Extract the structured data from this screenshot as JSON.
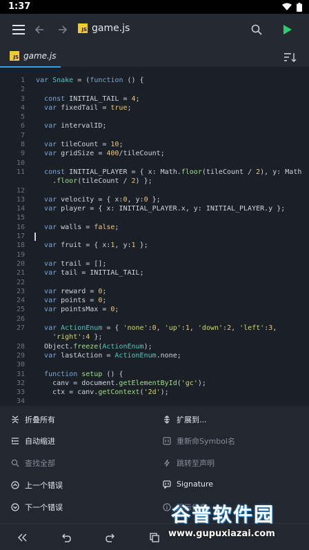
{
  "status_bar": {
    "time": "1:37"
  },
  "toolbar": {
    "filename": "game.js",
    "file_badge": "JS"
  },
  "tabs": [
    {
      "label": "game.js",
      "badge": "JS"
    }
  ],
  "editor": {
    "cursor_line": 17,
    "lines": [
      {
        "n": "1",
        "t": "var Snake = (function () {"
      },
      {
        "n": "2",
        "t": ""
      },
      {
        "n": "3",
        "t": "  const INITIAL_TAIL = 4;"
      },
      {
        "n": "4",
        "t": "  var fixedTail = true;"
      },
      {
        "n": "5",
        "t": ""
      },
      {
        "n": "6",
        "t": "  var intervalID;"
      },
      {
        "n": "7",
        "t": ""
      },
      {
        "n": "8",
        "t": "  var tileCount = 10;"
      },
      {
        "n": "9",
        "t": "  var gridSize = 400/tileCount;"
      },
      {
        "n": "10",
        "t": ""
      },
      {
        "n": "11",
        "t": "  const INITIAL_PLAYER = { x: Math.floor(tileCount / 2), y: Math"
      },
      {
        "n": "",
        "t": "    .floor(tileCount / 2) };"
      },
      {
        "n": "12",
        "t": ""
      },
      {
        "n": "13",
        "t": "  var velocity = { x:0, y:0 };"
      },
      {
        "n": "14",
        "t": "  var player = { x: INITIAL_PLAYER.x, y: INITIAL_PLAYER.y };"
      },
      {
        "n": "15",
        "t": ""
      },
      {
        "n": "16",
        "t": "  var walls = false;"
      },
      {
        "n": "17",
        "t": ""
      },
      {
        "n": "18",
        "t": "  var fruit = { x:1, y:1 };"
      },
      {
        "n": "19",
        "t": ""
      },
      {
        "n": "20",
        "t": "  var trail = [];"
      },
      {
        "n": "21",
        "t": "  var tail = INITIAL_TAIL;"
      },
      {
        "n": "22",
        "t": ""
      },
      {
        "n": "23",
        "t": "  var reward = 0;"
      },
      {
        "n": "24",
        "t": "  var points = 0;"
      },
      {
        "n": "25",
        "t": "  var pointsMax = 0;"
      },
      {
        "n": "26",
        "t": ""
      },
      {
        "n": "27",
        "t": "  var ActionEnum = { 'none':0, 'up':1, 'down':2, 'left':3,"
      },
      {
        "n": "",
        "t": "    'right':4 };"
      },
      {
        "n": "28",
        "t": "  Object.freeze(ActionEnum);"
      },
      {
        "n": "29",
        "t": "  var lastAction = ActionEnum.none;"
      },
      {
        "n": "30",
        "t": ""
      },
      {
        "n": "31",
        "t": "  function setup () {"
      },
      {
        "n": "32",
        "t": "    canv = document.getElementById('gc');"
      },
      {
        "n": "33",
        "t": "    ctx = canv.getContext('2d');"
      },
      {
        "n": "34",
        "t": ""
      }
    ]
  },
  "menu": {
    "left": [
      {
        "label": "折叠所有",
        "icon": "fold-icon",
        "enabled": true
      },
      {
        "label": "自动缩进",
        "icon": "indent-icon",
        "enabled": true
      },
      {
        "label": "查找全部",
        "icon": "search-icon",
        "enabled": false
      },
      {
        "label": "上一个错误",
        "icon": "chevron-up-circle-icon",
        "enabled": true
      },
      {
        "label": "下一个错误",
        "icon": "chevron-down-circle-icon",
        "enabled": true
      }
    ],
    "right": [
      {
        "label": "扩展到...",
        "icon": "expand-icon",
        "enabled": true
      },
      {
        "label": "重新命Symbol名",
        "icon": "rename-icon",
        "enabled": false
      },
      {
        "label": "跳转至声明",
        "icon": "jump-icon",
        "enabled": false
      },
      {
        "label": "Signature",
        "icon": "signature-icon",
        "enabled": true
      },
      {
        "label": "显示信息",
        "icon": "info-icon",
        "enabled": false
      }
    ]
  },
  "watermark": {
    "title": "谷普软件园",
    "url": "www.gupuxiazai.com"
  },
  "colors": {
    "accent": "#3aa0e8",
    "run": "#2ecc71",
    "js_badge": "#f0c93a"
  }
}
